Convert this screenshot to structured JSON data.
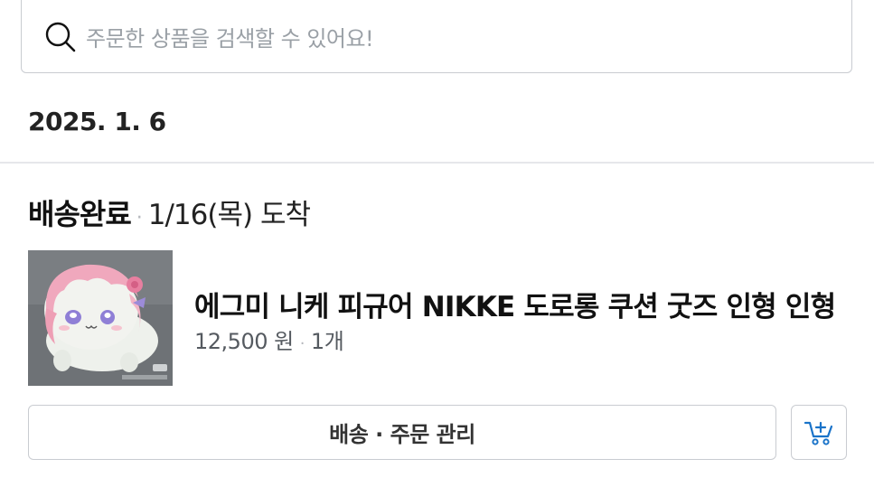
{
  "search": {
    "icon": "search-icon",
    "placeholder": "주문한 상품을 검색할 수 있어요!"
  },
  "order": {
    "date": "2025. 1. 6",
    "status": "배송완료",
    "separator": "·",
    "arrival": "1/16(목) 도착",
    "product": {
      "name": "에그미 니케 피규어 NIKKE 도로롱 쿠션 굿즈 인형 인형",
      "price": "12,500 원",
      "quantity": "1개",
      "thumbnail": "product-thumbnail-image"
    },
    "actions": {
      "manage_label": "배송 · 주문 관리",
      "cart_icon": "add-to-cart-icon"
    }
  },
  "colors": {
    "cart_icon": "#1a73c9",
    "placeholder": "#9aa0a6",
    "border": "#c9ccd1"
  }
}
